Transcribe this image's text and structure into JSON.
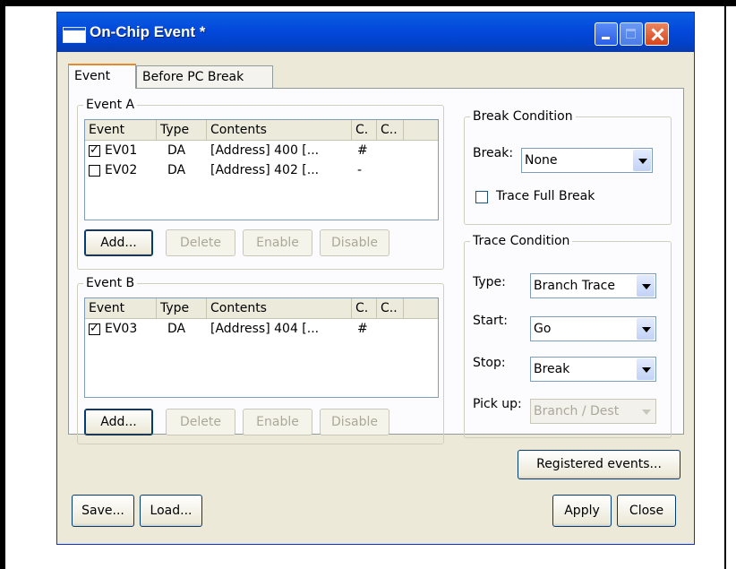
{
  "window": {
    "title": "On-Chip Event *"
  },
  "tabs": [
    {
      "label": "Event",
      "active": true
    },
    {
      "label": "Before PC Break",
      "active": false
    }
  ],
  "event_a": {
    "title": "Event A",
    "columns": [
      "Event",
      "Type",
      "Contents",
      "C.",
      "C.."
    ],
    "rows": [
      {
        "checked": true,
        "event": "EV01",
        "type": "DA",
        "contents": "[Address] 400 [...",
        "c1": "#"
      },
      {
        "checked": false,
        "event": "EV02",
        "type": "DA",
        "contents": "[Address] 402 [...",
        "c1": "-"
      }
    ],
    "buttons": {
      "add": "Add...",
      "delete": "Delete",
      "enable": "Enable",
      "disable": "Disable"
    }
  },
  "event_b": {
    "title": "Event B",
    "columns": [
      "Event",
      "Type",
      "Contents",
      "C.",
      "C.."
    ],
    "rows": [
      {
        "checked": true,
        "event": "EV03",
        "type": "DA",
        "contents": "[Address] 404 [...",
        "c1": "#"
      }
    ],
    "buttons": {
      "add": "Add...",
      "delete": "Delete",
      "enable": "Enable",
      "disable": "Disable"
    }
  },
  "break_condition": {
    "title": "Break Condition",
    "break_label": "Break:",
    "break_value": "None",
    "trace_full_label": "Trace Full Break",
    "trace_full_checked": false
  },
  "trace_condition": {
    "title": "Trace Condition",
    "type_label": "Type:",
    "type_value": "Branch Trace",
    "start_label": "Start:",
    "start_value": "Go",
    "stop_label": "Stop:",
    "stop_value": "Break",
    "pickup_label": "Pick up:",
    "pickup_value": "Branch / Dest"
  },
  "footer": {
    "registered": "Registered events...",
    "save": "Save...",
    "load": "Load...",
    "apply": "Apply",
    "close": "Close"
  }
}
